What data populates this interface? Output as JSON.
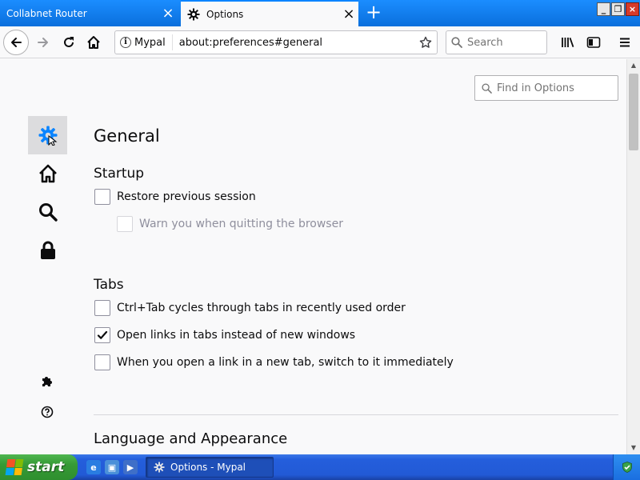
{
  "tabs": [
    {
      "title": "Collabnet Router",
      "active": false
    },
    {
      "title": "Options",
      "active": true
    }
  ],
  "navbar": {
    "identity_label": "Mypal",
    "url": "about:preferences#general",
    "search_placeholder": "Search"
  },
  "content": {
    "find_placeholder": "Find in Options",
    "page_title": "General",
    "startup": {
      "heading": "Startup",
      "restore_session": {
        "label": "Restore previous session",
        "checked": false
      },
      "warn_quit": {
        "label": "Warn you when quitting the browser",
        "checked": false,
        "disabled": true
      }
    },
    "tabs_section": {
      "heading": "Tabs",
      "ctrl_tab": {
        "label": "Ctrl+Tab cycles through tabs in recently used order",
        "checked": false
      },
      "open_links": {
        "label": "Open links in tabs instead of new windows",
        "checked": true
      },
      "switch_new_tab": {
        "label": "When you open a link in a new tab, switch to it immediately",
        "checked": false
      }
    },
    "language_heading": "Language and Appearance"
  },
  "sidebar": {
    "items": [
      "gear-icon",
      "home-icon",
      "search-icon",
      "lock-icon"
    ],
    "selected": "gear-icon"
  },
  "taskbar": {
    "start_label": "start",
    "task_label": "Options - Mypal"
  },
  "colors": {
    "accent": "#0a84ff",
    "taskbar": "#245edc",
    "start_green": "#369a36"
  }
}
